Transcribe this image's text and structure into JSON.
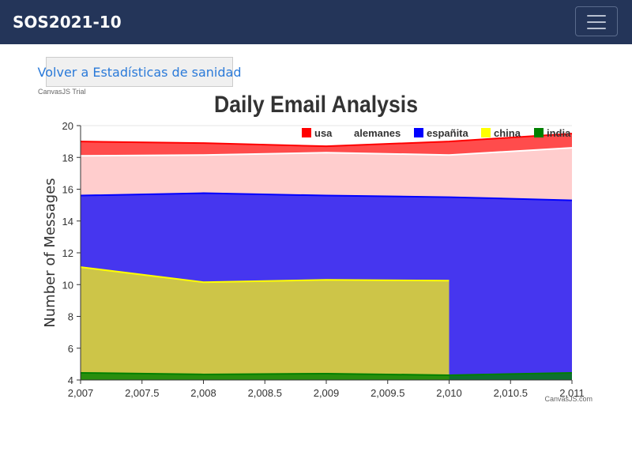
{
  "navbar": {
    "brand": "SOS2021-10",
    "menu_icon": "hamburger-icon"
  },
  "back_button": {
    "label": "Volver a Estadísticas de sanidad"
  },
  "watermarks": {
    "trial": "CanvasJS Trial",
    "credit": "CanvasJS.com"
  },
  "chart_data": {
    "type": "area",
    "title": "Daily Email Analysis",
    "xlabel": "",
    "ylabel": "Number of Messages",
    "xlim": [
      2007,
      2011
    ],
    "ylim": [
      4,
      20
    ],
    "x_ticks": [
      2007,
      2007.5,
      2008,
      2008.5,
      2009,
      2009.5,
      2010,
      2010.5,
      2011
    ],
    "x_tick_labels": [
      "2,007",
      "2,007.5",
      "2,008",
      "2,008.5",
      "2,009",
      "2,009.5",
      "2,010",
      "2,010.5",
      "2,011"
    ],
    "y_ticks": [
      4,
      6,
      8,
      10,
      12,
      14,
      16,
      18,
      20
    ],
    "y_tick_labels": [
      "4",
      "6",
      "8",
      "10",
      "12",
      "14",
      "16",
      "18",
      "20"
    ],
    "grid": true,
    "legend_position": "top-right",
    "series": [
      {
        "name": "usa",
        "color": "#ff0000",
        "fill": "rgba(255,0,0,0.7)",
        "x": [
          2007,
          2008,
          2009,
          2010,
          2011
        ],
        "y": [
          19.0,
          18.9,
          18.7,
          19.0,
          19.5
        ]
      },
      {
        "name": "alemanes",
        "color": "#ffffff",
        "fill": "rgba(255,205,205,1)",
        "x": [
          2007,
          2008,
          2009,
          2010,
          2011
        ],
        "y": [
          18.1,
          18.15,
          18.3,
          18.15,
          18.6
        ]
      },
      {
        "name": "españita",
        "color": "#0000ff",
        "fill": "rgba(60,45,240,0.95)",
        "x": [
          2007,
          2008,
          2009,
          2010,
          2011
        ],
        "y": [
          15.6,
          15.75,
          15.6,
          15.5,
          15.3
        ]
      },
      {
        "name": "china",
        "color": "#ffff00",
        "fill": "rgba(205,197,72,1)",
        "x": [
          2007,
          2008,
          2009,
          2010
        ],
        "y": [
          11.1,
          10.15,
          10.3,
          10.25
        ]
      },
      {
        "name": "india",
        "color": "#008000",
        "fill": "rgba(0,128,0,0.8)",
        "x": [
          2007,
          2008,
          2009,
          2010,
          2011
        ],
        "y": [
          4.45,
          4.35,
          4.4,
          4.3,
          4.45
        ]
      }
    ]
  }
}
